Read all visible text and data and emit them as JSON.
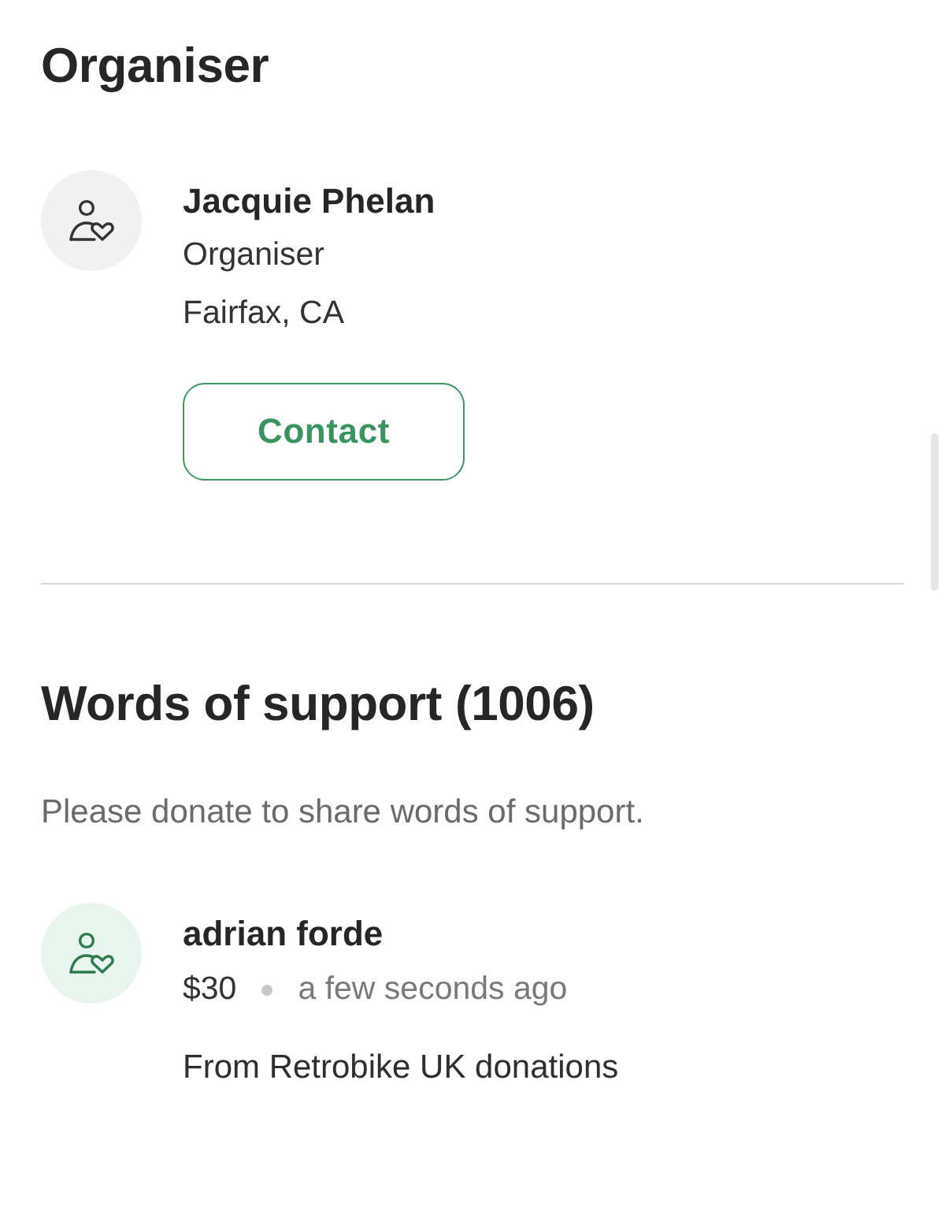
{
  "organiser": {
    "heading": "Organiser",
    "name": "Jacquie Phelan",
    "role": "Organiser",
    "location": "Fairfax, CA",
    "button": "Contact"
  },
  "support": {
    "heading": "Words of support (1006)",
    "note": "Please donate to share words of support.",
    "entries": [
      {
        "name": "adrian forde",
        "amount": "$30",
        "time": "a few seconds ago",
        "message": "From Retrobike UK donations"
      }
    ]
  }
}
